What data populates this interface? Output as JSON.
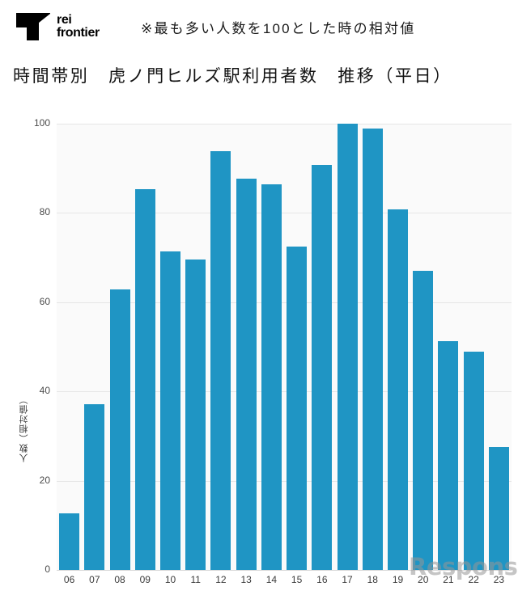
{
  "brand": {
    "logo_line1": "rei",
    "logo_line2": "frontier",
    "logo_icon": "flag-icon"
  },
  "header": {
    "note": "※最も多い人数を100とした時の相対値"
  },
  "title": "時間帯別　虎ノ門ヒルズ駅利用者数　推移（平日）",
  "watermark": "Response.",
  "colors": {
    "bar": "#1f95c4",
    "plot_background": "#fafafa",
    "gridline": "#e6e6e6",
    "axis": "#d9d9d9",
    "text": "#3c3c3c"
  },
  "chart_data": {
    "type": "bar",
    "title": "時間帯別　虎ノ門ヒルズ駅利用者数　推移（平日）",
    "subtitle": "※最も多い人数を100とした時の相対値",
    "xlabel": "",
    "ylabel": "人数（相対値）",
    "categories": [
      "06",
      "07",
      "08",
      "09",
      "10",
      "11",
      "12",
      "13",
      "14",
      "15",
      "16",
      "17",
      "18",
      "19",
      "20",
      "21",
      "22",
      "23"
    ],
    "values": [
      12.7,
      37.1,
      62.8,
      85.4,
      71.4,
      69.5,
      93.8,
      87.6,
      86.4,
      72.4,
      90.8,
      100.0,
      99.0,
      80.8,
      67.0,
      51.2,
      48.9,
      27.5
    ],
    "ylim": [
      0,
      100
    ],
    "yticks": [
      0,
      20,
      40,
      60,
      80,
      100
    ],
    "ytick_labels": [
      "0",
      "20",
      "40",
      "60",
      "80",
      "100"
    ],
    "grid": true,
    "legend": false
  }
}
